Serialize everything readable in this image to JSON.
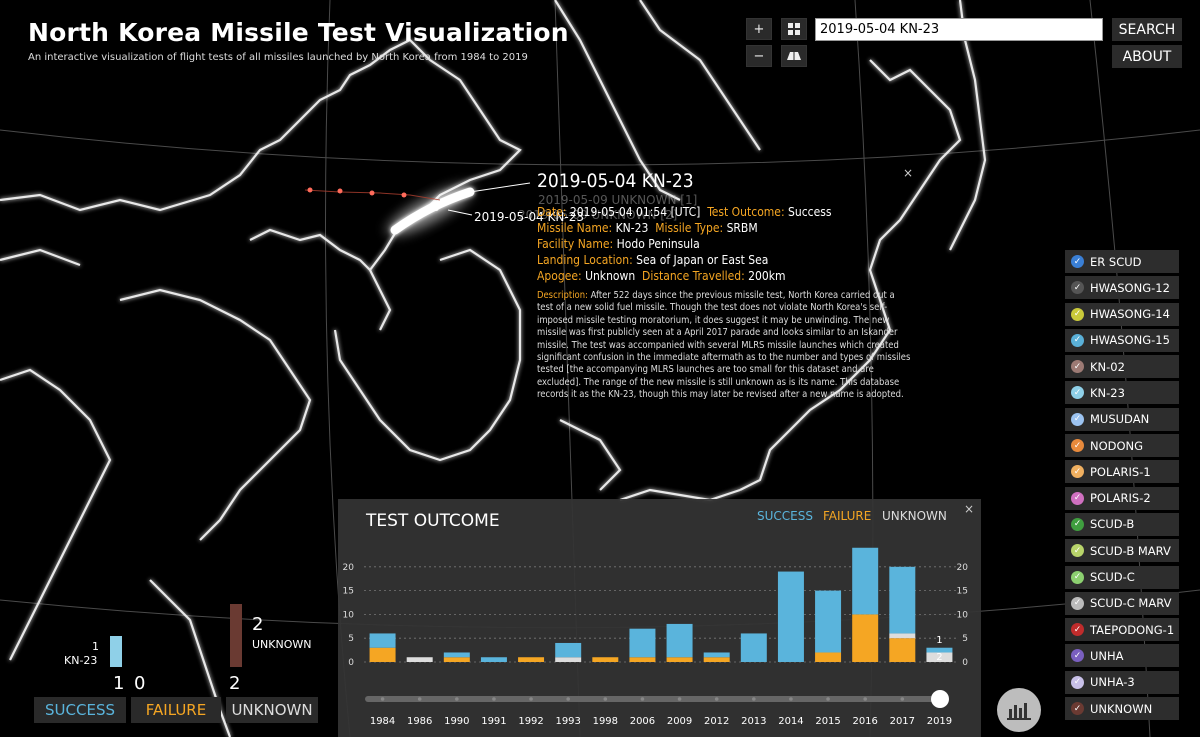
{
  "app": {
    "title": "North Korea Missile Test Visualization",
    "subtitle": "An interactive visualization of flight tests of all missiles launched by North Korea from 1984 to 2019"
  },
  "controls": {
    "zoom_in": "+",
    "zoom_out": "−",
    "search_value": "2019-05-04 KN-23",
    "search_button": "SEARCH",
    "about_button": "ABOUT"
  },
  "map_labels": {
    "launch_point": "2019-05-04 KN-23",
    "ghost_1": "2019-05-09 UNKNOWN [1]",
    "ghost_2": "2019-05-09 UNKNOWN [2]"
  },
  "info": {
    "title": "2019-05-04 KN-23",
    "date_label": "Date:",
    "date": "2019-05-04 01:54 [UTC]",
    "outcome_label": "Test Outcome:",
    "outcome": "Success",
    "name_label": "Missile Name:",
    "name": "KN-23",
    "type_label": "Missile Type:",
    "type": "SRBM",
    "facility_label": "Facility Name:",
    "facility": "Hodo Peninsula",
    "landing_label": "Landing Location:",
    "landing": "Sea of Japan or East Sea",
    "apogee_label": "Apogee:",
    "apogee": "Unknown",
    "distance_label": "Distance Travelled:",
    "distance": "200km",
    "description_label": "Description:",
    "description": "After 522 days since the previous missile test, North Korea carried out a test of a new solid fuel missile. Though the test does not violate North Korea's self-imposed missile testing moratorium, it does suggest it may be unwinding. The new missile was first publicly seen at a April 2017 parade and looks similar to an Iskander missile. The test was accompanied with several MLRS missile launches which created significant confusion in the immediate aftermath as to the number and types of missiles tested [the accompanying MLRS launches are too small for this dataset and are excluded]. The range of the new missile is still unknown as is its name. This database records it as the KN-23, though this may later be revised after a new name is adopted.",
    "close": "×"
  },
  "legend": [
    {
      "label": "ER SCUD",
      "color": "#3a7fd5"
    },
    {
      "label": "HWASONG-12",
      "color": "#555555"
    },
    {
      "label": "HWASONG-14",
      "color": "#c9c93a"
    },
    {
      "label": "HWASONG-15",
      "color": "#5ab0d8"
    },
    {
      "label": "KN-02",
      "color": "#9c7a74"
    },
    {
      "label": "KN-23",
      "color": "#8fd0e8"
    },
    {
      "label": "MUSUDAN",
      "color": "#9cc3f0"
    },
    {
      "label": "NODONG",
      "color": "#e88a3c"
    },
    {
      "label": "POLARIS-1",
      "color": "#f0b060"
    },
    {
      "label": "POLARIS-2",
      "color": "#d070c0"
    },
    {
      "label": "SCUD-B",
      "color": "#3f9e3f"
    },
    {
      "label": "SCUD-B MARV",
      "color": "#b8d46a"
    },
    {
      "label": "SCUD-C",
      "color": "#8cd070"
    },
    {
      "label": "SCUD-C MARV",
      "color": "#bbbbbb"
    },
    {
      "label": "TAEPODONG-1",
      "color": "#c02c2c"
    },
    {
      "label": "UNHA",
      "color": "#7a5fc0"
    },
    {
      "label": "UNHA-3",
      "color": "#c8c0e8"
    },
    {
      "label": "UNKNOWN",
      "color": "#6a3a32"
    }
  ],
  "chart_data": {
    "type": "bar",
    "title": "TEST OUTCOME",
    "legend": [
      "SUCCESS",
      "FAILURE",
      "UNKNOWN"
    ],
    "colors": {
      "success": "#5ab4dc",
      "failure": "#f5a623",
      "unknown": "#dddddd"
    },
    "categories": [
      "1984",
      "1986",
      "1990",
      "1991",
      "1992",
      "1993",
      "1998",
      "2006",
      "2009",
      "2012",
      "2013",
      "2014",
      "2015",
      "2016",
      "2017",
      "2019"
    ],
    "series": [
      {
        "name": "SUCCESS",
        "values": [
          3,
          0,
          1,
          1,
          0,
          3,
          0,
          6,
          7,
          1,
          6,
          19,
          13,
          14,
          14,
          1
        ]
      },
      {
        "name": "FAILURE",
        "values": [
          3,
          0,
          1,
          0,
          1,
          0,
          1,
          1,
          1,
          1,
          0,
          0,
          2,
          10,
          5,
          0
        ]
      },
      {
        "name": "UNKNOWN",
        "values": [
          0,
          1,
          0,
          0,
          0,
          1,
          0,
          0,
          0,
          0,
          0,
          0,
          0,
          0,
          1,
          2
        ]
      }
    ],
    "yticks": [
      0,
      5,
      10,
      15,
      20
    ],
    "ylim": [
      0,
      25
    ],
    "bar_labels": {
      "2019": [
        "1",
        "2"
      ]
    },
    "grid": true,
    "slider_value": "2019"
  },
  "stats": {
    "kn23_count": "1",
    "kn23_label": "KN-23",
    "unknown_count": "2",
    "unknown_label": "UNKNOWN",
    "success_total": "1",
    "failure_total": "0",
    "unknown_total": "2",
    "success_label": "SUCCESS",
    "failure_label": "FAILURE",
    "unknown_btn_label": "UNKNOWN"
  },
  "close_chart": "×"
}
